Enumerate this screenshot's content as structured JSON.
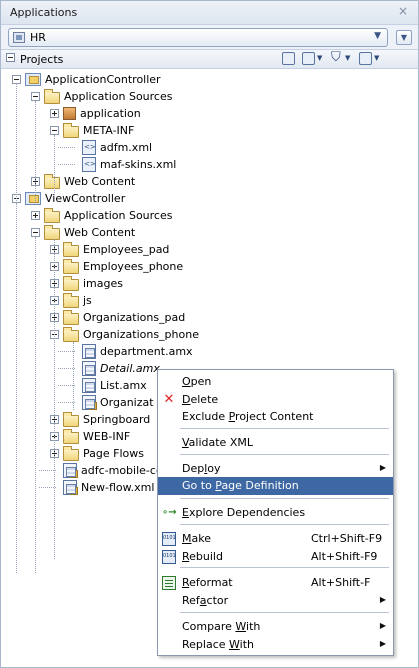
{
  "window": {
    "title": "Applications",
    "close_glyph": "×"
  },
  "app_selector": {
    "value": "HR",
    "arrow": "▼",
    "menu_arrow": "▼"
  },
  "projects": {
    "label": "Projects"
  },
  "tree": [
    {
      "label": "ApplicationController",
      "icon": "project-icon",
      "level": 0,
      "toggle": "minus"
    },
    {
      "label": "Application Sources",
      "icon": "folder-icon",
      "level": 1,
      "toggle": "minus"
    },
    {
      "label": "application",
      "icon": "package-icon",
      "level": 2,
      "toggle": "plus"
    },
    {
      "label": "META-INF",
      "icon": "folder-icon",
      "level": 2,
      "toggle": "minus"
    },
    {
      "label": "adfm.xml",
      "icon": "xml-file-icon",
      "level": 3,
      "toggle": "none"
    },
    {
      "label": "maf-skins.xml",
      "icon": "xml-file-icon",
      "level": 3,
      "toggle": "none"
    },
    {
      "label": "Web Content",
      "icon": "folder-icon",
      "level": 1,
      "toggle": "plus"
    },
    {
      "label": "ViewController",
      "icon": "project-icon",
      "level": 0,
      "toggle": "minus"
    },
    {
      "label": "Application Sources",
      "icon": "folder-icon",
      "level": 1,
      "toggle": "plus"
    },
    {
      "label": "Web Content",
      "icon": "folder-icon",
      "level": 1,
      "toggle": "minus"
    },
    {
      "label": "Employees_pad",
      "icon": "folder-icon",
      "level": 2,
      "toggle": "plus"
    },
    {
      "label": "Employees_phone",
      "icon": "folder-icon",
      "level": 2,
      "toggle": "plus"
    },
    {
      "label": "images",
      "icon": "folder-icon",
      "level": 2,
      "toggle": "plus"
    },
    {
      "label": "js",
      "icon": "folder-icon",
      "level": 2,
      "toggle": "plus"
    },
    {
      "label": "Organizations_pad",
      "icon": "folder-icon",
      "level": 2,
      "toggle": "plus"
    },
    {
      "label": "Organizations_phone",
      "icon": "folder-icon",
      "level": 2,
      "toggle": "minus"
    },
    {
      "label": "department.amx",
      "icon": "amx-file-icon",
      "level": 3,
      "toggle": "none"
    },
    {
      "label": "Detail.amx",
      "icon": "amx-file-icon",
      "level": 3,
      "toggle": "none",
      "italic": true
    },
    {
      "label": "List.amx",
      "icon": "amx-file-icon",
      "level": 3,
      "toggle": "none"
    },
    {
      "label": "Organizat",
      "icon": "amx-task-icon",
      "level": 3,
      "toggle": "none"
    },
    {
      "label": "Springboard",
      "icon": "folder-icon",
      "level": 2,
      "toggle": "plus"
    },
    {
      "label": "WEB-INF",
      "icon": "folder-icon",
      "level": 2,
      "toggle": "plus"
    },
    {
      "label": "Page Flows",
      "icon": "folder-icon",
      "level": 2,
      "toggle": "plus"
    },
    {
      "label": "adfc-mobile-co",
      "icon": "amx-task-icon",
      "level": 2,
      "toggle": "none"
    },
    {
      "label": "New-flow.xml",
      "icon": "amx-task-icon",
      "level": 2,
      "toggle": "none"
    }
  ],
  "context_menu": {
    "items": [
      {
        "label": "Open",
        "icon": "",
        "shortcut": "",
        "submenu": false
      },
      {
        "label": "Delete",
        "icon": "delete-icon",
        "shortcut": "",
        "submenu": false
      },
      {
        "label": "Exclude Project Content",
        "icon": "",
        "shortcut": "",
        "submenu": false
      },
      {
        "label": "Validate XML",
        "icon": "",
        "shortcut": "",
        "submenu": false
      },
      {
        "label": "Deploy",
        "icon": "",
        "shortcut": "",
        "submenu": true
      },
      {
        "label": "Go to Page Definition",
        "icon": "",
        "shortcut": "",
        "submenu": false,
        "selected": true
      },
      {
        "label": "Explore Dependencies",
        "icon": "dependencies-icon",
        "shortcut": "",
        "submenu": false
      },
      {
        "label": "Make",
        "icon": "make-icon",
        "shortcut": "Ctrl+Shift-F9",
        "submenu": false
      },
      {
        "label": "Rebuild",
        "icon": "rebuild-icon",
        "shortcut": "Alt+Shift-F9",
        "submenu": false
      },
      {
        "label": "Reformat",
        "icon": "reformat-icon",
        "shortcut": "Alt+Shift-F",
        "submenu": false
      },
      {
        "label": "Refactor",
        "icon": "",
        "shortcut": "",
        "submenu": true
      },
      {
        "label": "Compare With",
        "icon": "",
        "shortcut": "",
        "submenu": true
      },
      {
        "label": "Replace With",
        "icon": "",
        "shortcut": "",
        "submenu": true
      }
    ],
    "submenu_glyph": "▶",
    "delete_glyph": "✕",
    "dependencies_glyph": "∘→"
  },
  "colors": {
    "selection": "#3d68a3",
    "panel_border": "#a9b8cf",
    "header_bg": "#eef2f8"
  }
}
